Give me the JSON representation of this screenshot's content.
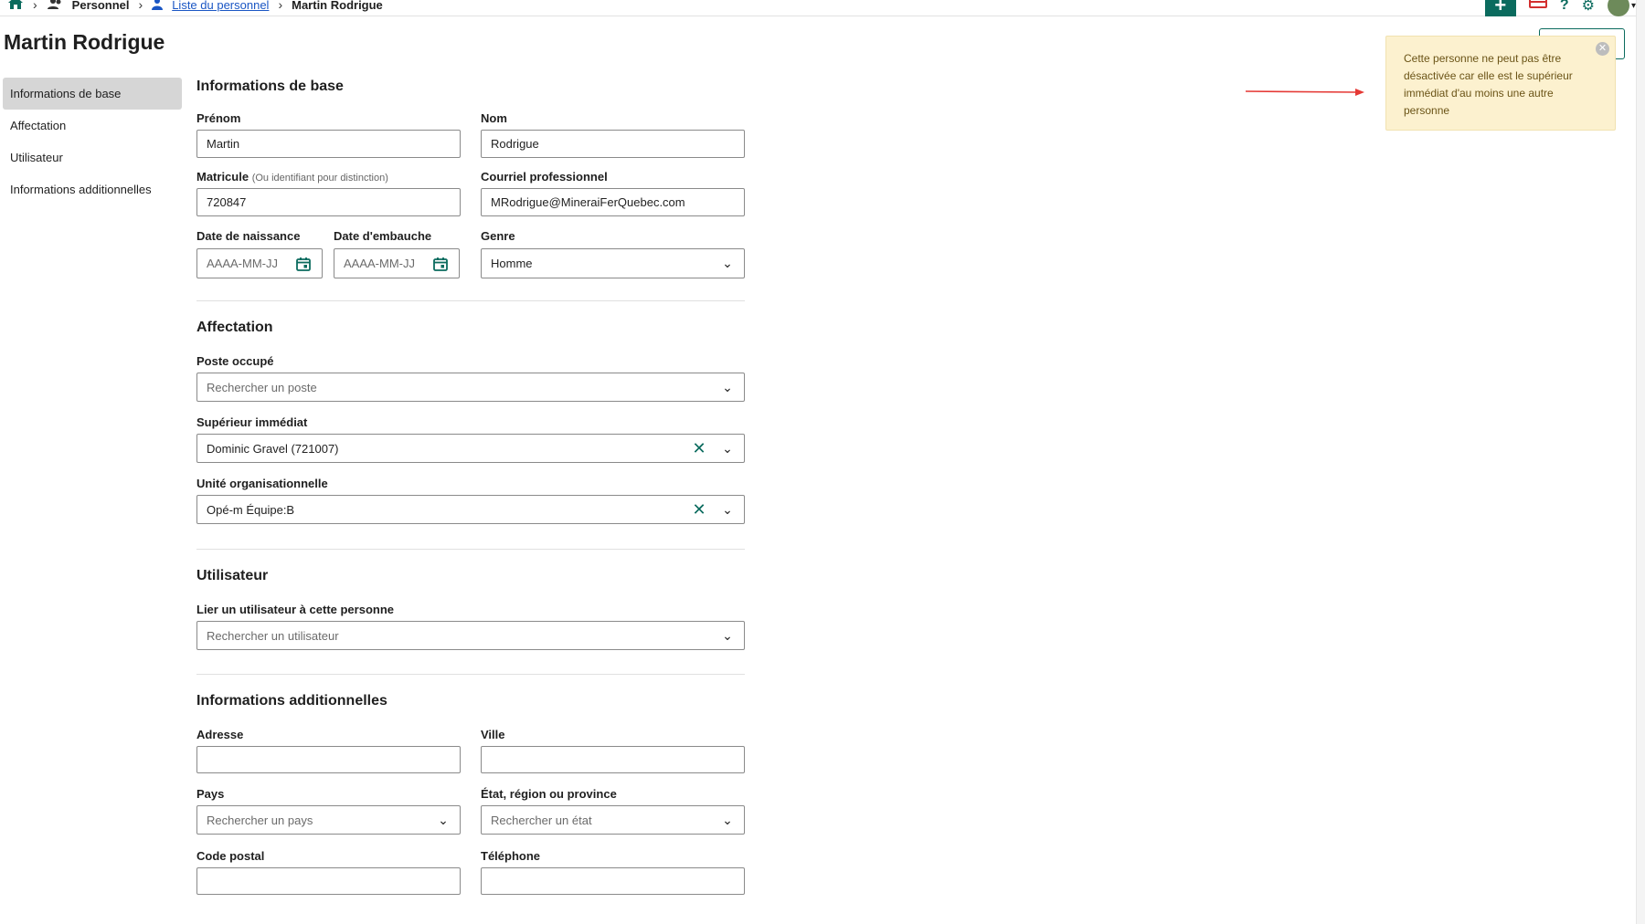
{
  "breadcrumb": {
    "items": [
      "Personnel",
      "Liste du personnel",
      "Martin Rodrigue"
    ]
  },
  "page": {
    "title": "Martin Rodrigue"
  },
  "sidenav": {
    "items": [
      "Informations de base",
      "Affectation",
      "Utilisateur",
      "Informations additionnelles"
    ],
    "active_index": 0
  },
  "basic": {
    "title": "Informations de base",
    "prenom_label": "Prénom",
    "prenom_value": "Martin",
    "nom_label": "Nom",
    "nom_value": "Rodrigue",
    "matricule_label": "Matricule",
    "matricule_hint": "(Ou identifiant pour distinction)",
    "matricule_value": "720847",
    "courriel_label": "Courriel professionnel",
    "courriel_value": "MRodrigue@MineraiFerQuebec.com",
    "naissance_label": "Date de naissance",
    "naissance_placeholder": "AAAA-MM-JJ",
    "embauche_label": "Date d'embauche",
    "embauche_placeholder": "AAAA-MM-JJ",
    "genre_label": "Genre",
    "genre_value": "Homme"
  },
  "affectation": {
    "title": "Affectation",
    "poste_label": "Poste occupé",
    "poste_placeholder": "Rechercher un poste",
    "superieur_label": "Supérieur immédiat",
    "superieur_value": "Dominic Gravel (721007)",
    "unite_label": "Unité organisationnelle",
    "unite_value": "Opé-m Équipe:B"
  },
  "utilisateur": {
    "title": "Utilisateur",
    "lier_label": "Lier un utilisateur à cette personne",
    "lier_placeholder": "Rechercher un utilisateur"
  },
  "additionnelles": {
    "title": "Informations additionnelles",
    "adresse_label": "Adresse",
    "ville_label": "Ville",
    "pays_label": "Pays",
    "pays_placeholder": "Rechercher un pays",
    "etat_label": "État, région ou province",
    "etat_placeholder": "Rechercher un état",
    "postal_label": "Code postal",
    "telephone_label": "Téléphone"
  },
  "alert": {
    "message": "Cette personne ne peut pas être désactivée car elle est le supérieur immédiat d'au moins une autre personne"
  },
  "colors": {
    "accent": "#0b6b5e",
    "alert_bg": "#fcf1cf",
    "arrow": "#e53935"
  }
}
